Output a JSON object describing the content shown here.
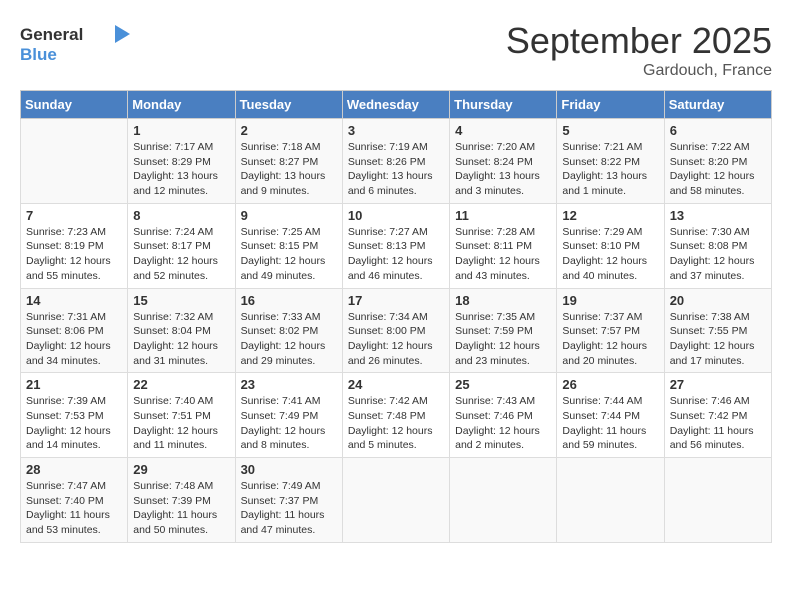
{
  "header": {
    "logo_general": "General",
    "logo_blue": "Blue",
    "month_year": "September 2025",
    "location": "Gardouch, France"
  },
  "columns": [
    "Sunday",
    "Monday",
    "Tuesday",
    "Wednesday",
    "Thursday",
    "Friday",
    "Saturday"
  ],
  "weeks": [
    [
      {
        "day": "",
        "sunrise": "",
        "sunset": "",
        "daylight": ""
      },
      {
        "day": "1",
        "sunrise": "Sunrise: 7:17 AM",
        "sunset": "Sunset: 8:29 PM",
        "daylight": "Daylight: 13 hours and 12 minutes."
      },
      {
        "day": "2",
        "sunrise": "Sunrise: 7:18 AM",
        "sunset": "Sunset: 8:27 PM",
        "daylight": "Daylight: 13 hours and 9 minutes."
      },
      {
        "day": "3",
        "sunrise": "Sunrise: 7:19 AM",
        "sunset": "Sunset: 8:26 PM",
        "daylight": "Daylight: 13 hours and 6 minutes."
      },
      {
        "day": "4",
        "sunrise": "Sunrise: 7:20 AM",
        "sunset": "Sunset: 8:24 PM",
        "daylight": "Daylight: 13 hours and 3 minutes."
      },
      {
        "day": "5",
        "sunrise": "Sunrise: 7:21 AM",
        "sunset": "Sunset: 8:22 PM",
        "daylight": "Daylight: 13 hours and 1 minute."
      },
      {
        "day": "6",
        "sunrise": "Sunrise: 7:22 AM",
        "sunset": "Sunset: 8:20 PM",
        "daylight": "Daylight: 12 hours and 58 minutes."
      }
    ],
    [
      {
        "day": "7",
        "sunrise": "Sunrise: 7:23 AM",
        "sunset": "Sunset: 8:19 PM",
        "daylight": "Daylight: 12 hours and 55 minutes."
      },
      {
        "day": "8",
        "sunrise": "Sunrise: 7:24 AM",
        "sunset": "Sunset: 8:17 PM",
        "daylight": "Daylight: 12 hours and 52 minutes."
      },
      {
        "day": "9",
        "sunrise": "Sunrise: 7:25 AM",
        "sunset": "Sunset: 8:15 PM",
        "daylight": "Daylight: 12 hours and 49 minutes."
      },
      {
        "day": "10",
        "sunrise": "Sunrise: 7:27 AM",
        "sunset": "Sunset: 8:13 PM",
        "daylight": "Daylight: 12 hours and 46 minutes."
      },
      {
        "day": "11",
        "sunrise": "Sunrise: 7:28 AM",
        "sunset": "Sunset: 8:11 PM",
        "daylight": "Daylight: 12 hours and 43 minutes."
      },
      {
        "day": "12",
        "sunrise": "Sunrise: 7:29 AM",
        "sunset": "Sunset: 8:10 PM",
        "daylight": "Daylight: 12 hours and 40 minutes."
      },
      {
        "day": "13",
        "sunrise": "Sunrise: 7:30 AM",
        "sunset": "Sunset: 8:08 PM",
        "daylight": "Daylight: 12 hours and 37 minutes."
      }
    ],
    [
      {
        "day": "14",
        "sunrise": "Sunrise: 7:31 AM",
        "sunset": "Sunset: 8:06 PM",
        "daylight": "Daylight: 12 hours and 34 minutes."
      },
      {
        "day": "15",
        "sunrise": "Sunrise: 7:32 AM",
        "sunset": "Sunset: 8:04 PM",
        "daylight": "Daylight: 12 hours and 31 minutes."
      },
      {
        "day": "16",
        "sunrise": "Sunrise: 7:33 AM",
        "sunset": "Sunset: 8:02 PM",
        "daylight": "Daylight: 12 hours and 29 minutes."
      },
      {
        "day": "17",
        "sunrise": "Sunrise: 7:34 AM",
        "sunset": "Sunset: 8:00 PM",
        "daylight": "Daylight: 12 hours and 26 minutes."
      },
      {
        "day": "18",
        "sunrise": "Sunrise: 7:35 AM",
        "sunset": "Sunset: 7:59 PM",
        "daylight": "Daylight: 12 hours and 23 minutes."
      },
      {
        "day": "19",
        "sunrise": "Sunrise: 7:37 AM",
        "sunset": "Sunset: 7:57 PM",
        "daylight": "Daylight: 12 hours and 20 minutes."
      },
      {
        "day": "20",
        "sunrise": "Sunrise: 7:38 AM",
        "sunset": "Sunset: 7:55 PM",
        "daylight": "Daylight: 12 hours and 17 minutes."
      }
    ],
    [
      {
        "day": "21",
        "sunrise": "Sunrise: 7:39 AM",
        "sunset": "Sunset: 7:53 PM",
        "daylight": "Daylight: 12 hours and 14 minutes."
      },
      {
        "day": "22",
        "sunrise": "Sunrise: 7:40 AM",
        "sunset": "Sunset: 7:51 PM",
        "daylight": "Daylight: 12 hours and 11 minutes."
      },
      {
        "day": "23",
        "sunrise": "Sunrise: 7:41 AM",
        "sunset": "Sunset: 7:49 PM",
        "daylight": "Daylight: 12 hours and 8 minutes."
      },
      {
        "day": "24",
        "sunrise": "Sunrise: 7:42 AM",
        "sunset": "Sunset: 7:48 PM",
        "daylight": "Daylight: 12 hours and 5 minutes."
      },
      {
        "day": "25",
        "sunrise": "Sunrise: 7:43 AM",
        "sunset": "Sunset: 7:46 PM",
        "daylight": "Daylight: 12 hours and 2 minutes."
      },
      {
        "day": "26",
        "sunrise": "Sunrise: 7:44 AM",
        "sunset": "Sunset: 7:44 PM",
        "daylight": "Daylight: 11 hours and 59 minutes."
      },
      {
        "day": "27",
        "sunrise": "Sunrise: 7:46 AM",
        "sunset": "Sunset: 7:42 PM",
        "daylight": "Daylight: 11 hours and 56 minutes."
      }
    ],
    [
      {
        "day": "28",
        "sunrise": "Sunrise: 7:47 AM",
        "sunset": "Sunset: 7:40 PM",
        "daylight": "Daylight: 11 hours and 53 minutes."
      },
      {
        "day": "29",
        "sunrise": "Sunrise: 7:48 AM",
        "sunset": "Sunset: 7:39 PM",
        "daylight": "Daylight: 11 hours and 50 minutes."
      },
      {
        "day": "30",
        "sunrise": "Sunrise: 7:49 AM",
        "sunset": "Sunset: 7:37 PM",
        "daylight": "Daylight: 11 hours and 47 minutes."
      },
      {
        "day": "",
        "sunrise": "",
        "sunset": "",
        "daylight": ""
      },
      {
        "day": "",
        "sunrise": "",
        "sunset": "",
        "daylight": ""
      },
      {
        "day": "",
        "sunrise": "",
        "sunset": "",
        "daylight": ""
      },
      {
        "day": "",
        "sunrise": "",
        "sunset": "",
        "daylight": ""
      }
    ]
  ]
}
